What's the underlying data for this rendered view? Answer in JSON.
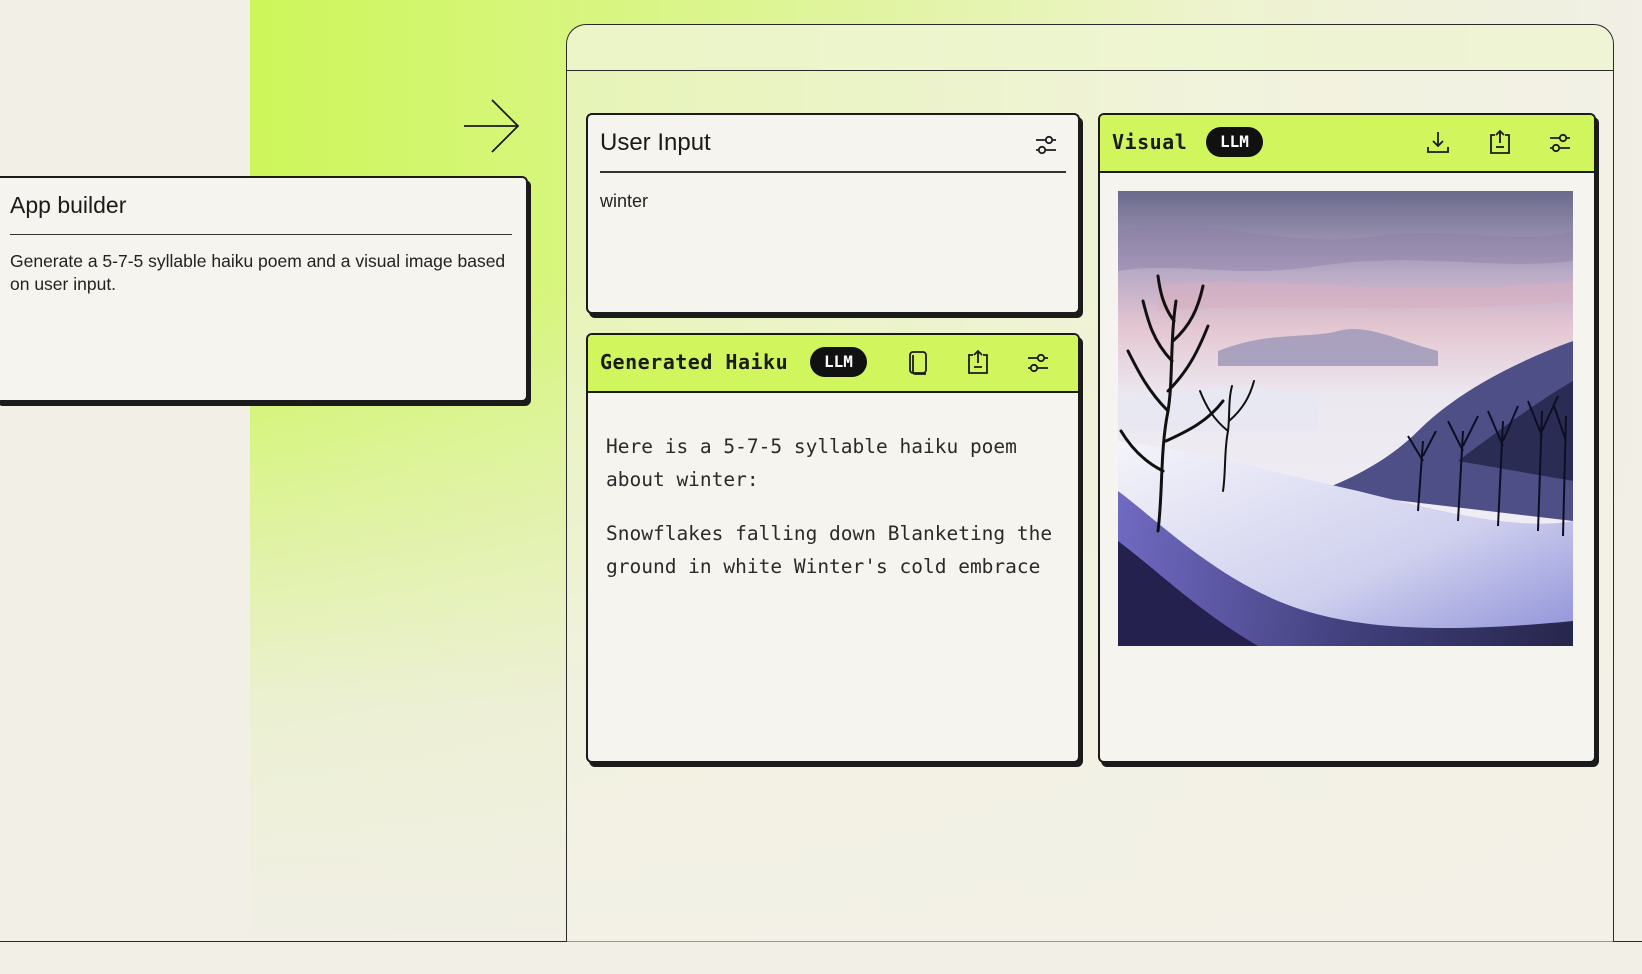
{
  "builder": {
    "title": "App builder",
    "description": "Generate a 5-7-5 syllable haiku poem and a visual image based on user input."
  },
  "user_input": {
    "title": "User Input",
    "value": "winter",
    "icons": [
      "settings-sliders-icon"
    ]
  },
  "haiku": {
    "title": "Generated Haiku",
    "badge": "LLM",
    "intro": "Here is a 5-7-5 syllable haiku poem about winter:",
    "poem": "Snowflakes falling down Blanketing the ground in white Winter's cold embrace",
    "icons": [
      "copy-icon",
      "share-icon",
      "settings-sliders-icon"
    ]
  },
  "visual": {
    "title": "Visual",
    "badge": "LLM",
    "image": "winter-landscape-image",
    "icons": [
      "download-icon",
      "share-icon",
      "settings-sliders-icon"
    ]
  },
  "colors": {
    "accent_green": "#d1f55c",
    "badge_bg": "#111111",
    "background": "#f1efe6"
  }
}
